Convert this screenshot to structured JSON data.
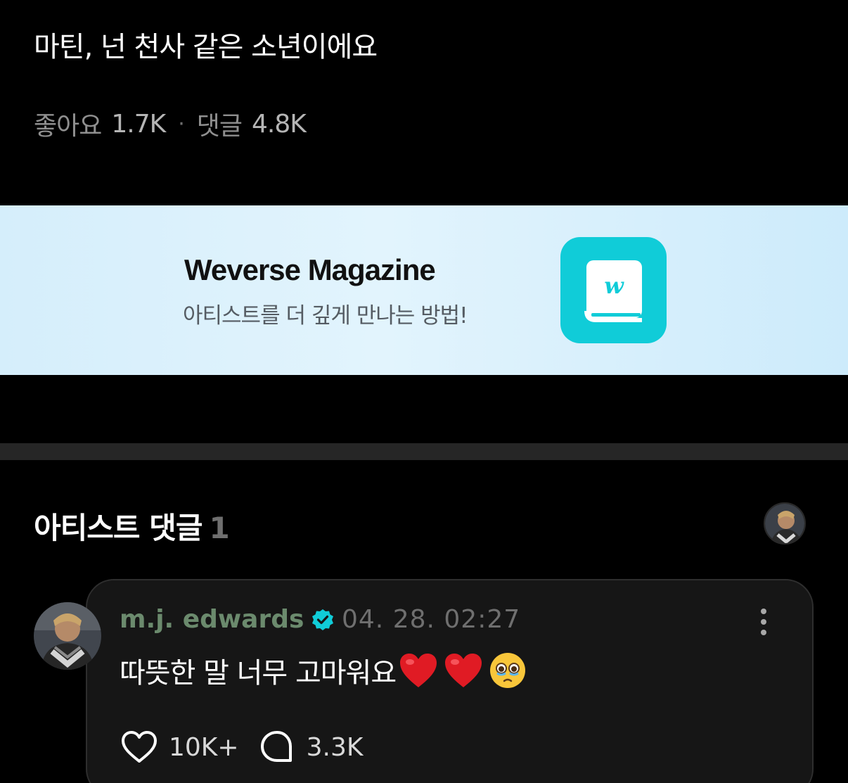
{
  "post": {
    "title": "마틴, 넌 천사 같은 소년이에요",
    "likes_label": "좋아요",
    "likes_count": "1.7K",
    "separator": "·",
    "comments_label": "댓글",
    "comments_count": "4.8K"
  },
  "banner": {
    "title": "Weverse Magazine",
    "subtitle": "아티스트를 더 깊게 만나는 방법!",
    "app_icon_color": "#10ccd8",
    "icon": "weverse-magazine-book-icon"
  },
  "artist_comments": {
    "section_title": "아티스트 댓글",
    "count": "1",
    "comment": {
      "author": "m.j. edwards",
      "verified": true,
      "timestamp": "04. 28. 02:27",
      "text": "따뜻한 말 너무 고마워요",
      "emojis": [
        "❤️",
        "❤️",
        "🥹"
      ],
      "likes": "10K+",
      "replies": "3.3K",
      "author_color": "#6b8a6d",
      "verified_color": "#10ccd8"
    }
  }
}
